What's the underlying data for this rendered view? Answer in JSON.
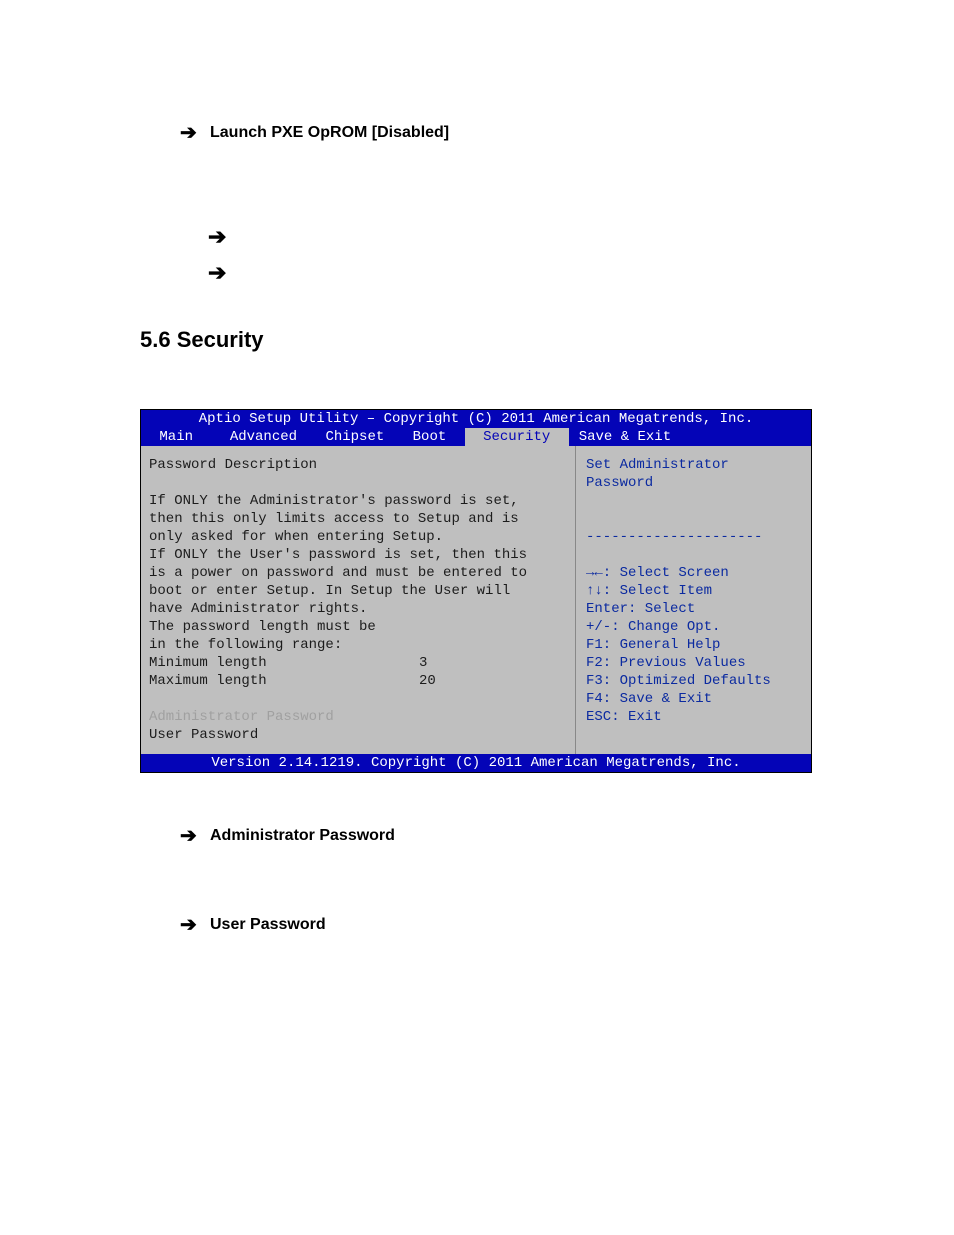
{
  "top_bullet": {
    "arrow": "➔",
    "label": "Launch PXE OpROM [Disabled]"
  },
  "empty_arrow": "➔",
  "section_heading": "5.6 Security",
  "bios": {
    "title": "Aptio Setup Utility – Copyright (C) 2011 American Megatrends, Inc.",
    "tabs": {
      "main": " Main ",
      "advanced": " Advanced ",
      "chipset": "Chipset",
      "boot": " Boot ",
      "security": " Security ",
      "save_exit": "Save & Exit"
    },
    "left": {
      "heading": "Password Description",
      "lines": [
        "If ONLY the Administrator's password is set,",
        "then this only limits access to Setup and is",
        "only asked for when entering Setup.",
        "If ONLY the User's password is set, then this",
        "is a power on password and must be entered to",
        "boot or enter Setup. In Setup the User will",
        "have Administrator rights.",
        "The password length must be",
        "in the following range:"
      ],
      "min_label": "Minimum length",
      "min_value": "3",
      "max_label": "Maximum length",
      "max_value": "20",
      "admin_pw": "Administrator Password",
      "user_pw": "User Password"
    },
    "right": {
      "help_line1": "Set Administrator",
      "help_line2": "Password",
      "dashes": "---------------------",
      "nav": [
        "→←: Select Screen",
        "↑↓: Select Item",
        "Enter: Select",
        "+/-:  Change Opt.",
        "F1:  General Help",
        "F2:  Previous Values",
        "F3:  Optimized Defaults",
        "F4:  Save & Exit",
        "ESC: Exit"
      ]
    },
    "footer": "Version 2.14.1219. Copyright (C) 2011 American Megatrends, Inc."
  },
  "sub_bullets": {
    "admin": "Administrator Password",
    "user": "User Password"
  }
}
